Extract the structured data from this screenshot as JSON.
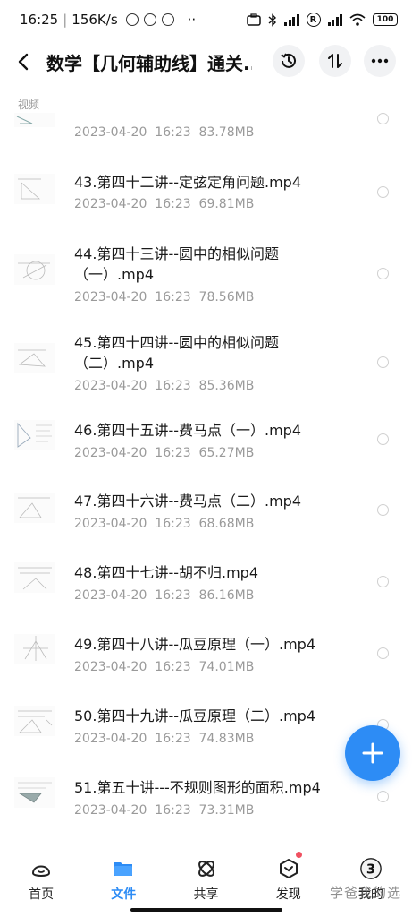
{
  "status_bar": {
    "time": "16:25",
    "speed": "156K/s",
    "battery": "100",
    "dots": "··"
  },
  "header": {
    "title": "数学【几何辅助线】通关..."
  },
  "section_label": "视频",
  "files": [
    {
      "name": "",
      "date": "2023-04-20",
      "time": "16:23",
      "size": "83.78MB"
    },
    {
      "name": "43.第四十二讲--定弦定角问题.mp4",
      "date": "2023-04-20",
      "time": "16:23",
      "size": "69.81MB"
    },
    {
      "name": "44.第四十三讲--圆中的相似问题（一）.mp4",
      "date": "2023-04-20",
      "time": "16:23",
      "size": "78.56MB"
    },
    {
      "name": "45.第四十四讲--圆中的相似问题（二）.mp4",
      "date": "2023-04-20",
      "time": "16:23",
      "size": "85.36MB"
    },
    {
      "name": "46.第四十五讲--费马点（一）.mp4",
      "date": "2023-04-20",
      "time": "16:23",
      "size": "65.27MB"
    },
    {
      "name": "47.第四十六讲--费马点（二）.mp4",
      "date": "2023-04-20",
      "time": "16:23",
      "size": "68.68MB"
    },
    {
      "name": "48.第四十七讲--胡不归.mp4",
      "date": "2023-04-20",
      "time": "16:23",
      "size": "86.16MB"
    },
    {
      "name": "49.第四十八讲--瓜豆原理（一）.mp4",
      "date": "2023-04-20",
      "time": "16:23",
      "size": "74.01MB"
    },
    {
      "name": "50.第四十九讲--瓜豆原理（二）.mp4",
      "date": "2023-04-20",
      "time": "16:23",
      "size": "74.83MB"
    },
    {
      "name": "51.第五十讲---不规则图形的面积.mp4",
      "date": "2023-04-20",
      "time": "16:23",
      "size": "73.31MB"
    }
  ],
  "fab_icon": "plus-icon",
  "nav": [
    {
      "label": "首页",
      "icon": "home-icon",
      "active": false
    },
    {
      "label": "文件",
      "icon": "folder-icon",
      "active": true
    },
    {
      "label": "共享",
      "icon": "share-icon",
      "active": false
    },
    {
      "label": "发现",
      "icon": "discover-icon",
      "active": false,
      "badge": true
    },
    {
      "label": "我的",
      "icon": "profile-icon",
      "active": false
    }
  ],
  "profile_badge": "3",
  "watermark": "学爸我的选",
  "colors": {
    "accent": "#2d8cf5",
    "badge": "#f05060",
    "meta": "#9a9a9a"
  }
}
